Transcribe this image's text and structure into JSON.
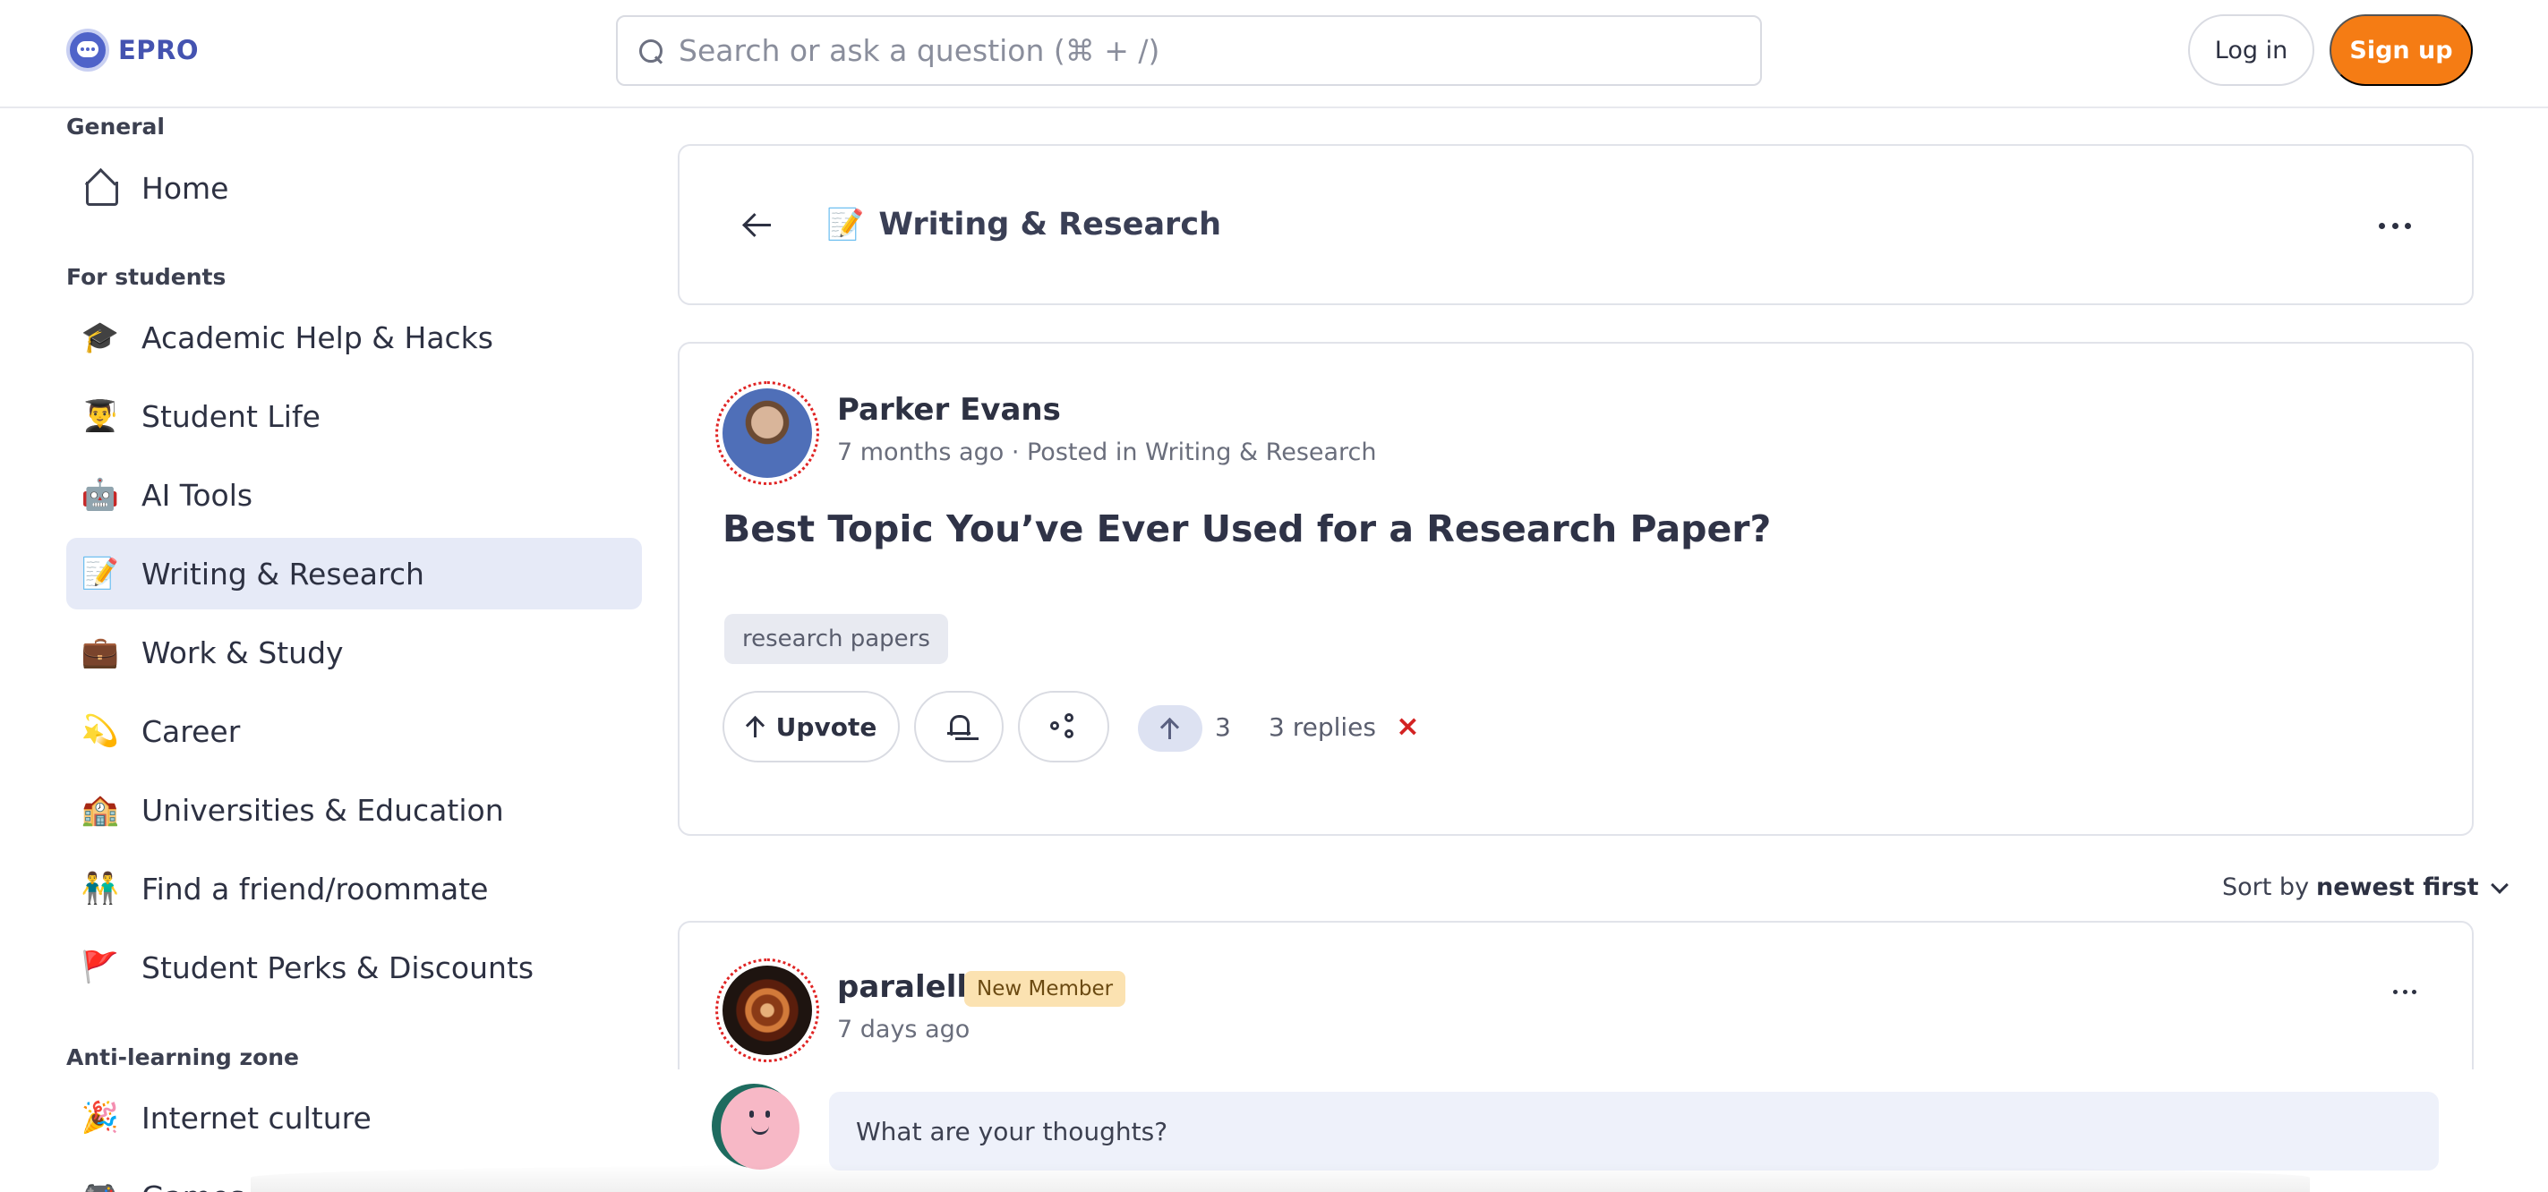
{
  "header": {
    "logo_text": "EPRO",
    "search_placeholder": "Search or ask a question (⌘ + /)",
    "login_label": "Log in",
    "signup_label": "Sign up"
  },
  "sidebar": {
    "sections": [
      {
        "label": "General"
      },
      {
        "label": "For students"
      },
      {
        "label": "Anti-learning zone"
      }
    ],
    "items": [
      {
        "label": "Home",
        "icon": "home-icon"
      },
      {
        "label": "Academic Help & Hacks",
        "emoji": "🎓"
      },
      {
        "label": "Student Life",
        "emoji": "👨‍🎓"
      },
      {
        "label": "AI Tools",
        "emoji": "🤖"
      },
      {
        "label": "Writing & Research",
        "emoji": "📝",
        "active": true
      },
      {
        "label": "Work & Study",
        "emoji": "💼"
      },
      {
        "label": "Career",
        "emoji": "💫"
      },
      {
        "label": "Universities & Education",
        "emoji": "🏫"
      },
      {
        "label": "Find a friend/roommate",
        "emoji": "👬"
      },
      {
        "label": "Student Perks & Discounts",
        "emoji": "🚩"
      },
      {
        "label": "Internet culture",
        "emoji": "🎉"
      },
      {
        "label": "Games",
        "emoji": "🎮"
      }
    ]
  },
  "topic": {
    "emoji": "📝",
    "title": "Writing & Research"
  },
  "post": {
    "author": "Parker Evans",
    "meta": "7 months ago · Posted in Writing & Research",
    "title": "Best Topic You’ve Ever Used for a Research Paper?",
    "tag": "research papers",
    "upvote_label": "Upvote",
    "vote_count": "3",
    "replies": "3 replies",
    "close_symbol": "×"
  },
  "sort": {
    "prefix": "Sort by",
    "value": "newest first"
  },
  "reply": {
    "author": "paralell",
    "badge": "New Member",
    "meta": "7 days ago"
  },
  "composer": {
    "placeholder": "What are your thoughts?"
  },
  "colors": {
    "accent": "#f57c14",
    "brand": "#4453b0",
    "active_nav": "#e6eaf7"
  }
}
